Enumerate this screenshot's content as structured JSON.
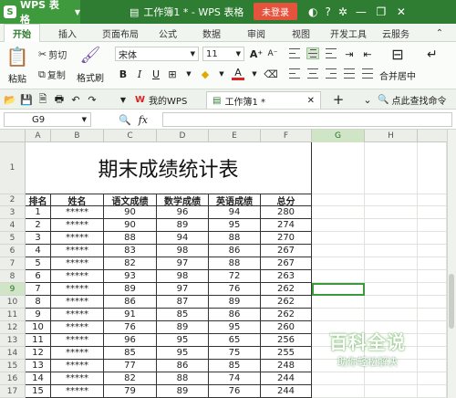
{
  "app": {
    "name": "WPS 表格",
    "logo_letter": "S",
    "doc_title": "工作簿1 * - WPS 表格",
    "login": "未登录"
  },
  "menu": [
    "开始",
    "插入",
    "页面布局",
    "公式",
    "数据",
    "审阅",
    "视图",
    "开发工具",
    "云服务"
  ],
  "ribbon": {
    "paste": "粘贴",
    "cut": "剪切",
    "copy": "复制",
    "format_painter": "格式刷",
    "font_name": "宋体",
    "font_size": "11",
    "bold": "B",
    "italic": "I",
    "underline": "U",
    "font_color_glyph": "A",
    "grow_glyph": "A⁺",
    "shrink_glyph": "A⁻",
    "merge_center": "合并居中"
  },
  "quickbar": {
    "mywps": "我的WPS",
    "doc_tab": "工作簿1 *",
    "search": "点此查找命令"
  },
  "formula_bar": {
    "name_box": "G9",
    "fx": "fx"
  },
  "columns": [
    "A",
    "B",
    "C",
    "D",
    "E",
    "F",
    "G",
    "H"
  ],
  "sheet": {
    "title": "期末成绩统计表",
    "headers": [
      "排名",
      "姓名",
      "语文成绩",
      "数学成绩",
      "英语成绩",
      "总分"
    ],
    "rows": [
      [
        "1",
        "*****",
        "90",
        "96",
        "94",
        "280"
      ],
      [
        "2",
        "*****",
        "90",
        "89",
        "95",
        "274"
      ],
      [
        "3",
        "*****",
        "88",
        "94",
        "88",
        "270"
      ],
      [
        "4",
        "*****",
        "83",
        "98",
        "86",
        "267"
      ],
      [
        "5",
        "*****",
        "82",
        "97",
        "88",
        "267"
      ],
      [
        "6",
        "*****",
        "93",
        "98",
        "72",
        "263"
      ],
      [
        "7",
        "*****",
        "89",
        "97",
        "76",
        "262"
      ],
      [
        "8",
        "*****",
        "86",
        "87",
        "89",
        "262"
      ],
      [
        "9",
        "*****",
        "91",
        "85",
        "86",
        "262"
      ],
      [
        "10",
        "*****",
        "76",
        "89",
        "95",
        "260"
      ],
      [
        "11",
        "*****",
        "96",
        "95",
        "65",
        "256"
      ],
      [
        "12",
        "*****",
        "85",
        "95",
        "75",
        "255"
      ],
      [
        "13",
        "*****",
        "77",
        "86",
        "85",
        "248"
      ],
      [
        "14",
        "*****",
        "82",
        "88",
        "74",
        "244"
      ],
      [
        "15",
        "*****",
        "79",
        "89",
        "76",
        "244"
      ]
    ],
    "row_numbers": [
      "1",
      "2",
      "3",
      "4",
      "5",
      "6",
      "7",
      "8",
      "9",
      "10",
      "11",
      "12",
      "13",
      "14",
      "15",
      "16",
      "17"
    ],
    "selected_row": "9"
  },
  "watermark": {
    "big": "百科全说",
    "small": "助你轻松解决"
  },
  "colors": {
    "title_bar": "#2f7d32",
    "login": "#e5533c",
    "selection": "#3c9a3c"
  }
}
